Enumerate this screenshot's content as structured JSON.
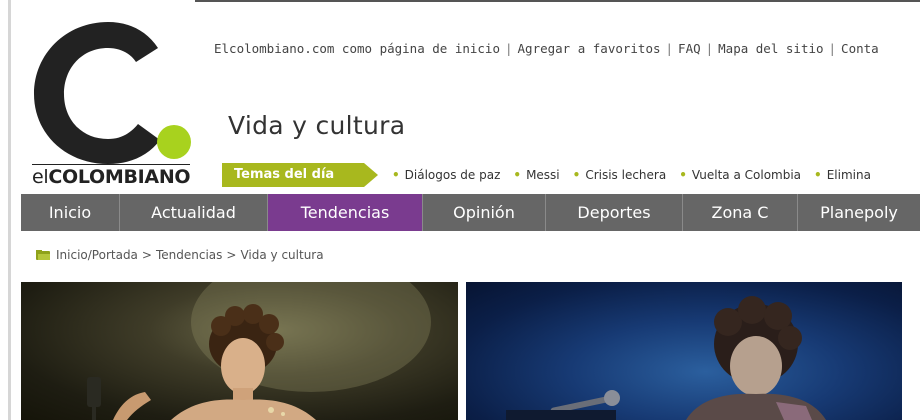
{
  "brand": {
    "name_thin": "el",
    "name_bold": "COLOMBIANO",
    "logo_letter": "C.",
    "accent_color": "#a8b81e"
  },
  "top_links": [
    "Elcolombiano.com como página de inicio",
    "Agregar a favoritos",
    "FAQ",
    "Mapa del sitio",
    "Conta"
  ],
  "top_links_separator": "|",
  "section_title": "Vida y cultura",
  "temas": {
    "label": "Temas del día",
    "items": [
      "Diálogos de paz",
      "Messi",
      "Crisis lechera",
      "Vuelta a Colombia",
      "Elimina"
    ]
  },
  "nav": {
    "items": [
      "Inicio",
      "Actualidad",
      "Tendencias",
      "Opinión",
      "Deportes",
      "Zona C",
      "Planepoly"
    ],
    "active": "Tendencias",
    "active_color": "#7a3b8f",
    "bar_color": "#666666"
  },
  "breadcrumb": {
    "icon": "folder-icon",
    "items": [
      "Inicio/Portada",
      "Tendencias",
      "Vida y cultura"
    ],
    "separator": ">"
  },
  "photos": [
    {
      "name": "photo-dancer",
      "description_icon": "image"
    },
    {
      "name": "photo-singer",
      "description_icon": "image"
    }
  ]
}
